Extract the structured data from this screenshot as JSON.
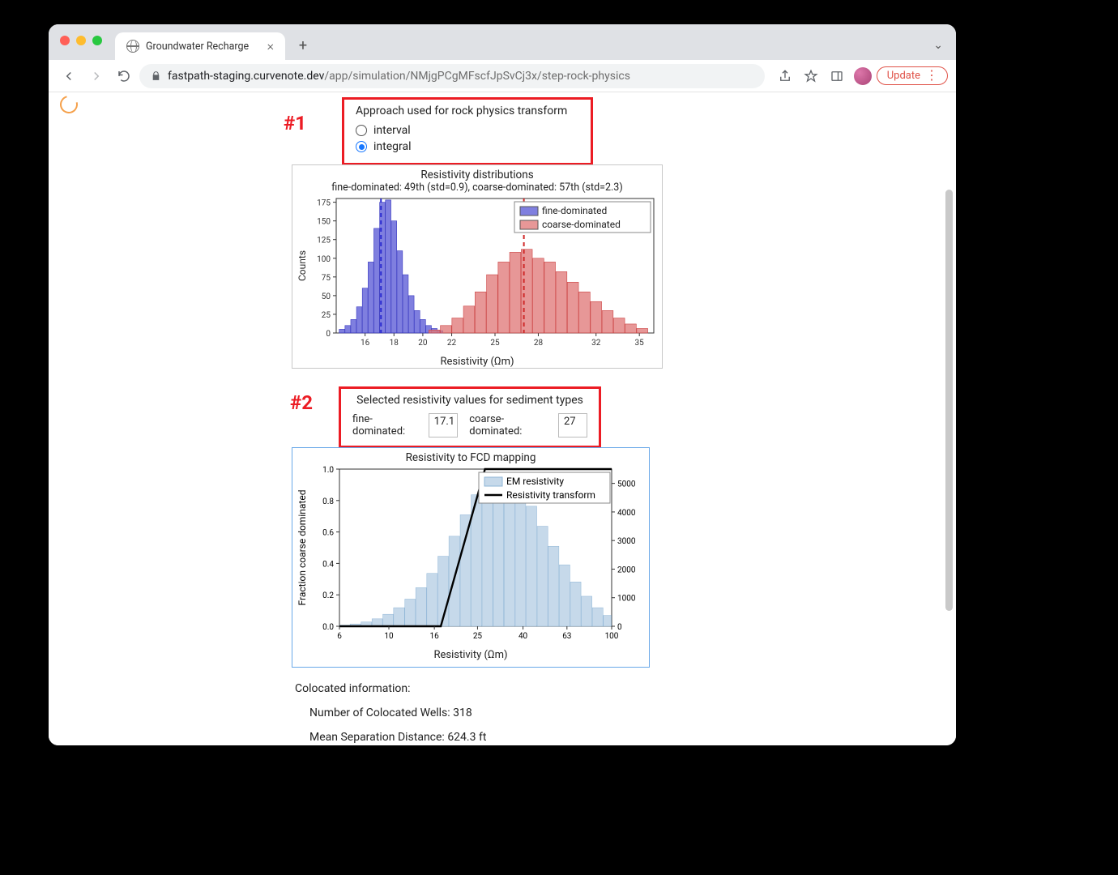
{
  "browser": {
    "tab_title": "Groundwater Recharge",
    "url_domain": "fastpath-staging.curvenote.dev",
    "url_path": "/app/simulation/NMjgPCgMFscfJpSvCj3x/step-rock-physics",
    "update_label": "Update"
  },
  "callouts": {
    "one": "#1",
    "two": "#2"
  },
  "section1": {
    "title": "Approach used for rock physics transform",
    "options": {
      "interval": "interval",
      "integral": "integral"
    },
    "selected": "integral"
  },
  "section2": {
    "title": "Selected resistivity values for sediment types",
    "fine_label": "fine-dominated:",
    "fine_value": "17.1",
    "coarse_label": "coarse-dominated:",
    "coarse_value": "27"
  },
  "info": {
    "heading": "Colocated information:",
    "wells_label": "Number of Colocated Wells:",
    "wells_value": "318",
    "mean_sep_label": "Mean Separation Distance:",
    "mean_sep_value": "624.3 ft"
  },
  "chart_data": [
    {
      "id": "resistivity_distributions",
      "type": "bar",
      "title": "Resistivity distributions",
      "subtitle": "fine-dominated: 49th (std=0.9), coarse-dominated: 57th (std=2.3)",
      "xlabel": "Resistivity (Ωm)",
      "ylabel": "Counts",
      "xlim": [
        14,
        36
      ],
      "ylim": [
        0,
        180
      ],
      "yticks": [
        0,
        25,
        50,
        75,
        100,
        125,
        150,
        175
      ],
      "xticks": [
        16,
        18,
        20,
        22,
        25,
        28,
        32,
        35
      ],
      "legend": [
        "fine-dominated",
        "coarse-dominated"
      ],
      "legend_colors": [
        "#5b5bd6",
        "#e07a7a"
      ],
      "vlines": [
        17.1,
        27
      ],
      "series": [
        {
          "name": "fine-dominated",
          "color": "#5b5bd6",
          "bins": [
            14.4,
            14.8,
            15.2,
            15.6,
            16.0,
            16.4,
            16.8,
            17.2,
            17.6,
            18.0,
            18.4,
            18.8,
            19.2,
            19.6,
            20.0,
            20.4,
            20.8,
            21.2
          ],
          "counts": [
            5,
            10,
            18,
            35,
            60,
            95,
            140,
            175,
            178,
            150,
            110,
            78,
            50,
            30,
            18,
            10,
            6,
            3
          ]
        },
        {
          "name": "coarse-dominated",
          "color": "#e07a7a",
          "bins": [
            20.8,
            21.6,
            22.4,
            23.2,
            24.0,
            24.8,
            25.6,
            26.4,
            27.2,
            28.0,
            28.8,
            29.6,
            30.4,
            31.2,
            32.0,
            32.8,
            33.6,
            34.4,
            35.2
          ],
          "counts": [
            4,
            10,
            20,
            36,
            55,
            78,
            95,
            108,
            112,
            100,
            95,
            82,
            68,
            55,
            42,
            30,
            20,
            12,
            6
          ]
        }
      ]
    },
    {
      "id": "resistivity_to_fcd",
      "type": "bar+line",
      "title": "Resistivity to FCD mapping",
      "xlabel": "Resistivity (Ωm)",
      "ylabel_left": "Fraction coarse dominated",
      "ylabel_right": "",
      "xlim": [
        6,
        100
      ],
      "ylim_left": [
        0.0,
        1.0
      ],
      "ylim_right": [
        0,
        5500
      ],
      "yticks_left": [
        0.0,
        0.2,
        0.4,
        0.6,
        0.8,
        1.0
      ],
      "yticks_right": [
        0,
        1000,
        2000,
        3000,
        4000,
        5000
      ],
      "xticks": [
        6,
        10,
        16,
        25,
        40,
        63,
        100
      ],
      "xscale": "log",
      "legend": [
        "EM resistivity",
        "Resistivity transform"
      ],
      "series": [
        {
          "name": "EM resistivity",
          "type": "bar",
          "axis": "right",
          "color": "#c6d9ea",
          "bins": [
            6,
            6.7,
            7.5,
            8.4,
            9.4,
            10.5,
            11.8,
            13.2,
            14.8,
            16.6,
            18.6,
            20.9,
            23.4,
            26.2,
            29.4,
            32.9,
            36.9,
            41.3,
            46.3,
            51.9,
            58.2,
            65.2,
            73.1,
            81.9,
            91.8,
            100
          ],
          "counts": [
            40,
            80,
            150,
            260,
            420,
            650,
            950,
            1350,
            1850,
            2450,
            3150,
            3900,
            4600,
            5100,
            5350,
            5200,
            4800,
            4200,
            3500,
            2800,
            2150,
            1550,
            1050,
            650,
            380,
            200
          ]
        },
        {
          "name": "Resistivity transform",
          "type": "line",
          "axis": "left",
          "color": "#000000",
          "x": [
            6,
            17.1,
            27,
            100
          ],
          "y": [
            0.0,
            0.0,
            1.0,
            1.0
          ]
        }
      ]
    }
  ]
}
